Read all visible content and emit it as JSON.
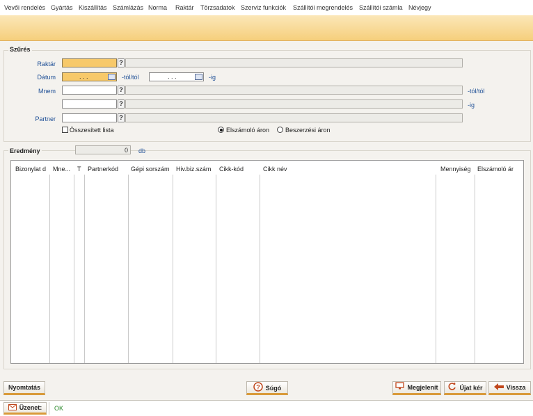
{
  "menu": [
    "Vevői rendelés",
    "Gyártás",
    "Kiszállítás",
    "Számlázás",
    "Norma",
    "Raktár",
    "Törzsadatok",
    "Szerviz funkciók",
    "Szállítói megrendelés",
    "Szállítói számla",
    "Névjegy"
  ],
  "filter": {
    "title": "Szűrés",
    "raktar_label": "Raktár",
    "datum_label": "Dátum",
    "mnem_label": "Mnem",
    "partner_label": "Partner",
    "date_placeholder": ". . .",
    "tol_label": "-tól/tól",
    "ig_label": "-ig",
    "mnem_tol_label": "-tól/tól",
    "mnem_ig_label": "-ig",
    "q": "?",
    "summary_label": "Összesített lista",
    "radio1_label": "Elszámoló áron",
    "radio2_label": "Beszerzési áron"
  },
  "result": {
    "title": "Eredmény",
    "count": "0",
    "unit": "db"
  },
  "table": {
    "columns": [
      "Bizonylat d",
      "Mne...",
      "T",
      "Partnerkód",
      "Gépi sorszám",
      "Hiv.biz.szám",
      "Cikk-kód",
      "Cikk név",
      "Mennyiség",
      "Elszámoló ár"
    ]
  },
  "buttons": {
    "print": "Nyomtatás",
    "help": "Súgó",
    "show": "Megjelenít",
    "new_query": "Újat kér",
    "back": "Vissza"
  },
  "status": {
    "label": "Üzenet:",
    "message": "OK"
  },
  "colors": {
    "accent": "#f6cf7c",
    "label_blue": "#1e4f96",
    "button_underline": "#d99a3a"
  }
}
